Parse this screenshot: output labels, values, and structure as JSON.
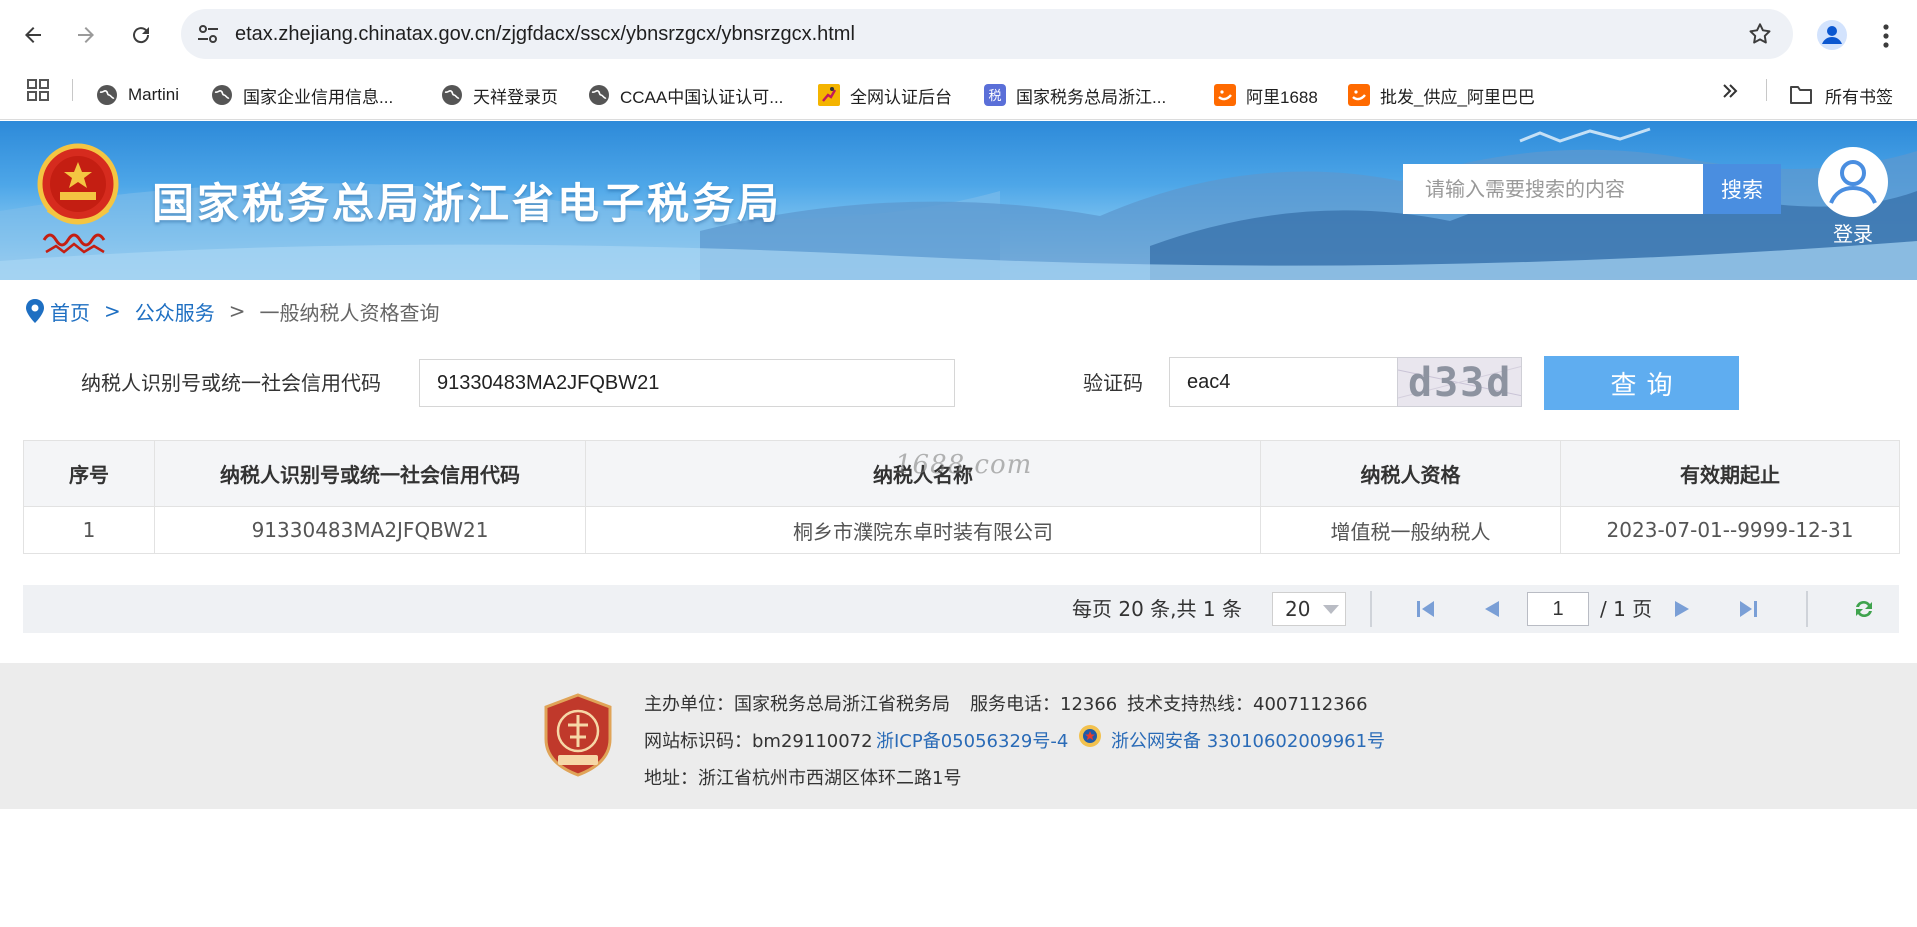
{
  "browser": {
    "url": "etax.zhejiang.chinatax.gov.cn/zjgfdacx/sscx/ybnsrzgcx/ybnsrzgcx.html",
    "bookmarks": [
      {
        "label": "Martini"
      },
      {
        "label": "国家企业信用信息..."
      },
      {
        "label": "天祥登录页"
      },
      {
        "label": "CCAA中国认证认可..."
      },
      {
        "label": "全网认证后台"
      },
      {
        "label": "国家税务总局浙江..."
      },
      {
        "label": "阿里1688"
      },
      {
        "label": "批发_供应_阿里巴巴"
      }
    ],
    "bookmark_folder": "所有书签",
    "tax_badge_text": "税"
  },
  "header": {
    "site_title": "国家税务总局浙江省电子税务局",
    "search_placeholder": "请输入需要搜索的内容",
    "search_button": "搜索",
    "login_label": "登录"
  },
  "breadcrumb": {
    "home": "首页",
    "section": "公众服务",
    "current": "一般纳税人资格查询",
    "separator": ">"
  },
  "form": {
    "tax_id_label": "纳税人识别号或统一社会信用代码",
    "tax_id_value": "91330483MA2JFQBW21",
    "captcha_label": "验证码",
    "captcha_value": "eac4",
    "captcha_image_text": "d33d",
    "query_button": "查询"
  },
  "table": {
    "headers": [
      "序号",
      "纳税人识别号或统一社会信用代码",
      "纳税人名称",
      "纳税人资格",
      "有效期起止"
    ],
    "rows": [
      [
        "1",
        "91330483MA2JFQBW21",
        "桐乡市濮院东卓时装有限公司",
        "增值税一般纳税人",
        "2023-07-01--9999-12-31"
      ]
    ],
    "watermark": "1688.com"
  },
  "pager": {
    "summary": "每页 20 条,共 1 条",
    "page_size": "20",
    "current_page": "1",
    "total_pages": "/ 1 页"
  },
  "footer": {
    "sponsor": "主办单位：国家税务总局浙江省税务局",
    "service_phone": "服务电话：12366",
    "support_hotline": "技术支持热线：4007112366",
    "site_id": "网站标识码：bm29110072",
    "icp": "浙ICP备05056329号-4",
    "police": "浙公网安备 33010602009961号",
    "address": "地址：浙江省杭州市西湖区体环二路1号"
  },
  "colors": {
    "brand_blue": "#1e6fc2",
    "query_button": "#5fadf0",
    "search_button": "#4a8ee0"
  }
}
